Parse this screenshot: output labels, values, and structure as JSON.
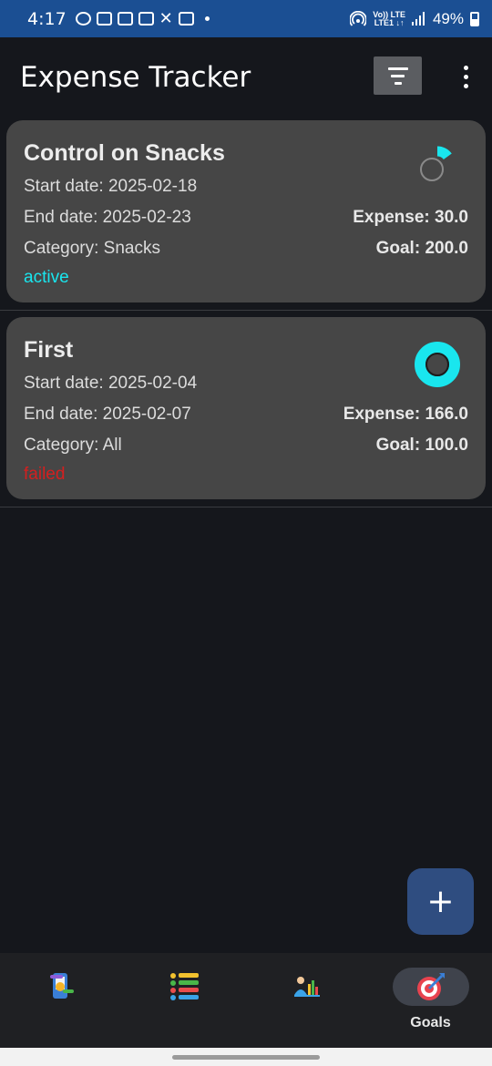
{
  "status_bar": {
    "time": "4:17",
    "network_top": "Vo)) LTE",
    "network_bottom": "LTE1 ↓↑",
    "battery": "49%"
  },
  "app_bar": {
    "title": "Expense Tracker",
    "filter_icon": "filter-icon",
    "menu_icon": "more-vert-icon"
  },
  "goals": [
    {
      "title": "Control on Snacks",
      "start_date": "Start date: 2025-02-18",
      "end_date": "End date: 2025-02-23",
      "category": "Category: Snacks",
      "expense": "Expense: 30.0",
      "goal": "Goal: 200.0",
      "status": "active",
      "status_color": "#19e6ee",
      "progress_fraction": 0.15
    },
    {
      "title": "First",
      "start_date": "Start date: 2025-02-04",
      "end_date": "End date: 2025-02-07",
      "category": "Category: All",
      "expense": "Expense: 166.0",
      "goal": "Goal: 100.0",
      "status": "failed",
      "status_color": "#d41f1f",
      "progress_fraction": 1.0
    }
  ],
  "fab": {
    "icon": "plus-icon"
  },
  "bottom_nav": {
    "items": [
      {
        "icon": "wallet-icon",
        "label": ""
      },
      {
        "icon": "list-icon",
        "label": ""
      },
      {
        "icon": "analytics-icon",
        "label": ""
      },
      {
        "icon": "target-icon",
        "label": "Goals",
        "active": true
      }
    ]
  },
  "colors": {
    "accent": "#19e6ee",
    "status_bar": "#1b4f93",
    "card": "#464646",
    "fab": "#2f4d80"
  }
}
